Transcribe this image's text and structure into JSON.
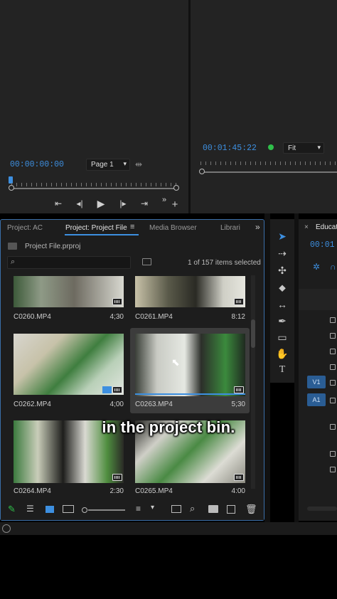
{
  "source_monitor": {
    "timecode": "00:00:00:00",
    "page_select": "Page 1"
  },
  "program_monitor": {
    "timecode": "00:01:45:22",
    "zoom_select": "Fit"
  },
  "project_panel": {
    "tabs": [
      {
        "label": "Project: AC"
      },
      {
        "label": "Project: Project File"
      },
      {
        "label": "Media Browser"
      },
      {
        "label": "Librari"
      }
    ],
    "project_file": "Project File.prproj",
    "search_placeholder": "",
    "items_selected": "1 of 157 items selected",
    "clips": [
      {
        "name": "C0260.MP4",
        "duration": "4;30"
      },
      {
        "name": "C0261.MP4",
        "duration": "8:12"
      },
      {
        "name": "C0262.MP4",
        "duration": "4;00"
      },
      {
        "name": "C0263.MP4",
        "duration": "5;30"
      },
      {
        "name": "C0264.MP4",
        "duration": "2:30"
      },
      {
        "name": "C0265.MP4",
        "duration": "4:00"
      }
    ]
  },
  "timeline": {
    "tab_label": "Educati",
    "timecode": "00:01",
    "tracks": [
      "V1",
      "A1"
    ]
  },
  "caption": "in the project bin.",
  "colors": {
    "accent": "#3d8fe0",
    "panel": "#1d1d1d",
    "selection_border": "#3a6ea8"
  }
}
